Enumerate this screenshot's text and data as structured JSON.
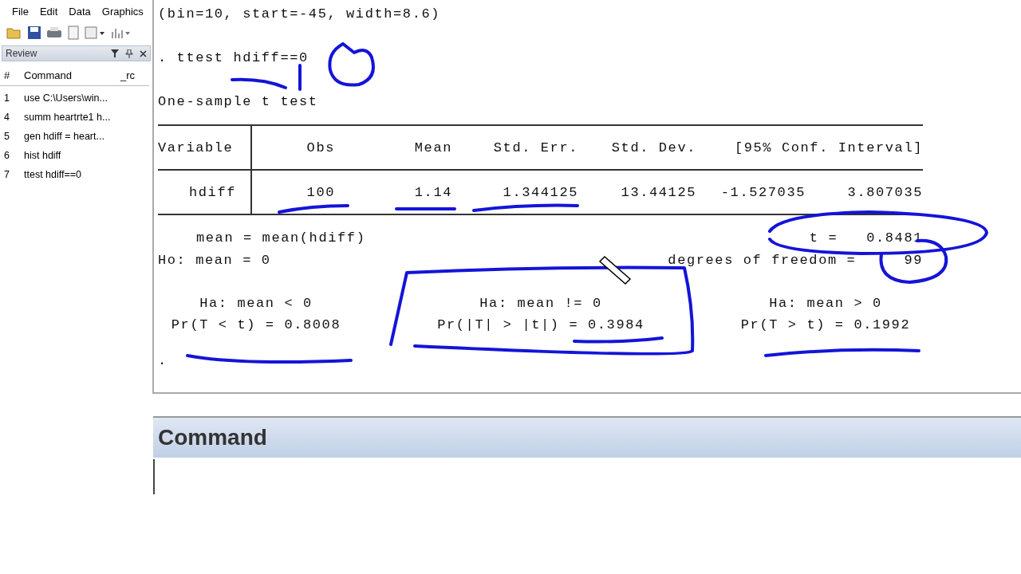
{
  "menu": [
    "File",
    "Edit",
    "Data",
    "Graphics"
  ],
  "review": {
    "title": "Review",
    "columns": [
      "#",
      "Command",
      "_rc"
    ],
    "rows": [
      {
        "num": "1",
        "command": "use C:\\Users\\win..."
      },
      {
        "num": "4",
        "command": "summ heartrte1 h..."
      },
      {
        "num": "5",
        "command": "gen hdiff = heart..."
      },
      {
        "num": "6",
        "command": "hist hdiff"
      },
      {
        "num": "7",
        "command": "ttest hdiff==0"
      }
    ]
  },
  "results": {
    "previous_line": "(bin=10, start=-45, width=8.6)",
    "command_line": ". ttest hdiff==0",
    "title": "One-sample t test",
    "table": {
      "columns": [
        "Variable",
        "Obs",
        "Mean",
        "Std. Err.",
        "Std. Dev.",
        "[95% Conf. Interval]"
      ],
      "rows": [
        [
          "hdiff",
          "100",
          "1.14",
          "1.344125",
          "13.44125",
          "-1.527035",
          "3.807035"
        ]
      ]
    },
    "mean_line": "mean = mean(hdiff)",
    "t_label": "t =",
    "t_value": "0.8481",
    "ho_line": "Ho: mean = 0",
    "df_label": "degrees of freedom =",
    "df_value": "99",
    "hypotheses": [
      {
        "ha": "Ha: mean < 0",
        "pr": "Pr(T < t) = 0.8008"
      },
      {
        "ha": "Ha: mean != 0",
        "pr": "Pr(|T| > |t|) = 0.3984"
      },
      {
        "ha": "Ha: mean > 0",
        "pr": "Pr(T > t) = 0.1992"
      }
    ],
    "prompt": "."
  },
  "command_panel": {
    "title": "Command"
  }
}
